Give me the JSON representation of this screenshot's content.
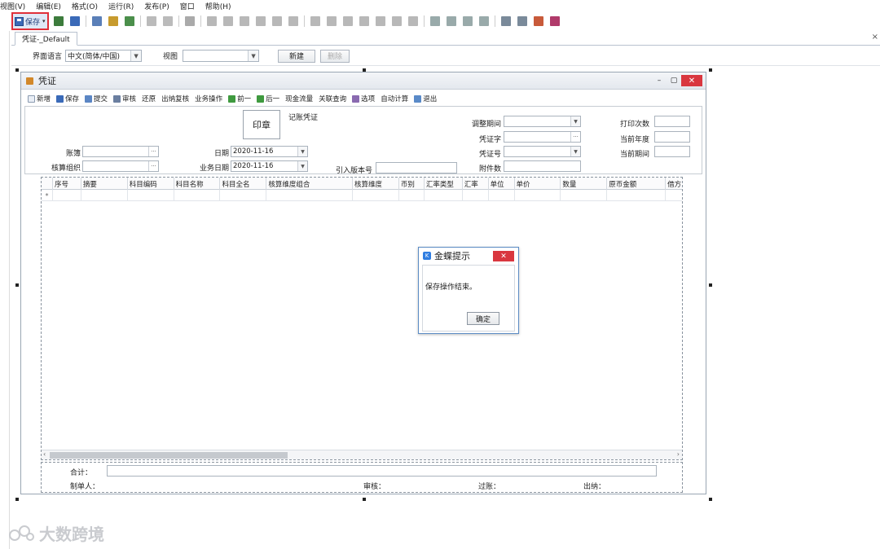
{
  "menu": [
    "视图(V)",
    "编辑(E)",
    "格式(O)",
    "运行(R)",
    "发布(P)",
    "窗口",
    "帮助(H)"
  ],
  "toolbar": {
    "save_label": "保存",
    "save_caret": "▾"
  },
  "tab": {
    "label": "凭证-_Default",
    "close": "×"
  },
  "designer": {
    "lang_label": "界面语言",
    "lang_value": "中文(简体/中国)",
    "view_label": "视图",
    "view_value": "",
    "new_button": "新建",
    "delete_button": "删除"
  },
  "form": {
    "title": "凭证",
    "min": "–",
    "max": "▢",
    "close": "✕",
    "toolbar": [
      "新增",
      "保存",
      "提交",
      "审核",
      "还原",
      "出纳复核",
      "业务操作",
      "前一",
      "后一",
      "现金流量",
      "关联查询",
      "选项",
      "自动计算",
      "退出"
    ],
    "seal": "印章",
    "header_title": "记账凭证",
    "fields": {
      "ledger": "账簿",
      "acct_org": "核算组织",
      "date": "日期",
      "date_value": "2020-11-16",
      "biz_date": "业务日期",
      "biz_date_value": "2020-11-16",
      "import_ver": "引入版本号",
      "adjust_period": "调整期间",
      "voucher_word": "凭证字",
      "voucher_no": "凭证号",
      "attachments": "附件数",
      "print_count": "打印次数",
      "current_year": "当前年度",
      "current_period": "当前期间"
    },
    "grid_columns": [
      "序号",
      "摘要",
      "科目编码",
      "科目名称",
      "科目全名",
      "核算维度组合",
      "核算维度",
      "币别",
      "汇率类型",
      "汇率",
      "单位",
      "单价",
      "数量",
      "原币金额",
      "借方"
    ],
    "row_marker": "*",
    "footer": {
      "total": "合计：",
      "preparer": "制单人：",
      "reviewer": "审核：",
      "poster": "过账：",
      "cashier": "出纳："
    }
  },
  "dialog": {
    "title": "金蝶提示",
    "message": "保存操作结束。",
    "ok": "确定",
    "close": "✕"
  },
  "watermark": "大数跨境"
}
